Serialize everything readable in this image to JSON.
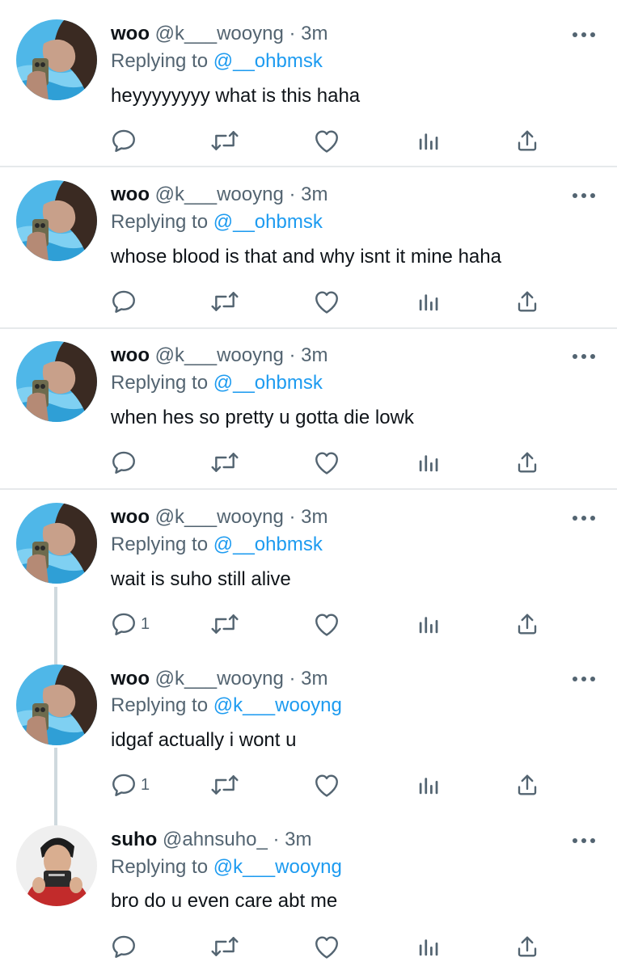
{
  "colors": {
    "accent": "#1d9bf0",
    "muted": "#536471",
    "text": "#0f1419",
    "divider": "#e6e9eb"
  },
  "tweets": [
    {
      "name": "woo",
      "handle": "@k___wooyng",
      "sep": "·",
      "time": "3m",
      "replying_prefix": "Replying to",
      "replying_to": "@__ohbmsk",
      "text": "heyyyyyyyy what is this haha",
      "reply_count": ""
    },
    {
      "name": "woo",
      "handle": "@k___wooyng",
      "sep": "·",
      "time": "3m",
      "replying_prefix": "Replying to",
      "replying_to": "@__ohbmsk",
      "text": "whose blood is that and why isnt it mine haha",
      "reply_count": ""
    },
    {
      "name": "woo",
      "handle": "@k___wooyng",
      "sep": "·",
      "time": "3m",
      "replying_prefix": "Replying to",
      "replying_to": "@__ohbmsk",
      "text": "when hes so pretty u gotta die lowk",
      "reply_count": ""
    },
    {
      "name": "woo",
      "handle": "@k___wooyng",
      "sep": "·",
      "time": "3m",
      "replying_prefix": "Replying to",
      "replying_to": "@__ohbmsk",
      "text": "wait is suho still alive",
      "reply_count": "1"
    },
    {
      "name": "woo",
      "handle": "@k___wooyng",
      "sep": "·",
      "time": "3m",
      "replying_prefix": "Replying to",
      "replying_to": "@k___wooyng",
      "text": "idgaf actually i wont u",
      "reply_count": "1"
    },
    {
      "name": "suho",
      "handle": "@ahnsuho_",
      "sep": "·",
      "time": "3m",
      "replying_prefix": "Replying to",
      "replying_to": "@k___wooyng",
      "text": "bro do u even care abt me",
      "reply_count": ""
    }
  ],
  "icons": [
    "more-icon",
    "reply-icon",
    "retweet-icon",
    "like-icon",
    "views-icon",
    "share-icon"
  ]
}
